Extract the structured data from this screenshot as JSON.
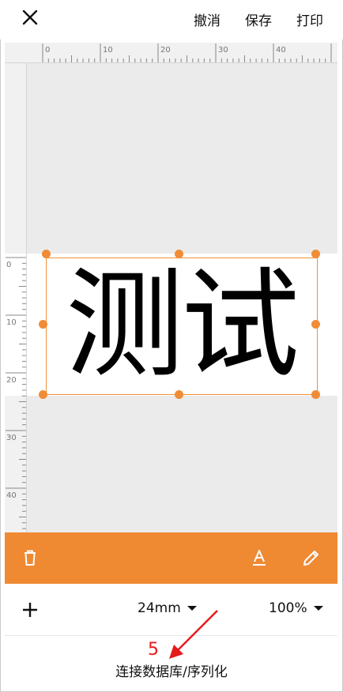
{
  "topbar": {
    "close_icon": "close-icon",
    "undo_label": "撤消",
    "save_label": "保存",
    "print_label": "打印"
  },
  "ruler": {
    "horizontal_ticks": [
      "0",
      "10",
      "20",
      "30",
      "40"
    ],
    "vertical_ticks": [
      "0",
      "10",
      "20",
      "30",
      "40"
    ]
  },
  "label": {
    "text": "测试"
  },
  "toolbar": {
    "delete_icon": "trash-icon",
    "font_icon": "text-format-icon",
    "edit_icon": "pencil-icon",
    "accent_color": "#ef8a33"
  },
  "bottom": {
    "add_icon": "plus-icon",
    "size_value": "24mm",
    "zoom_value": "100%"
  },
  "annotation": {
    "step_number": "5",
    "arrow_color": "#e61a1a"
  },
  "footer": {
    "connect_label": "连接数据库/序列化"
  }
}
